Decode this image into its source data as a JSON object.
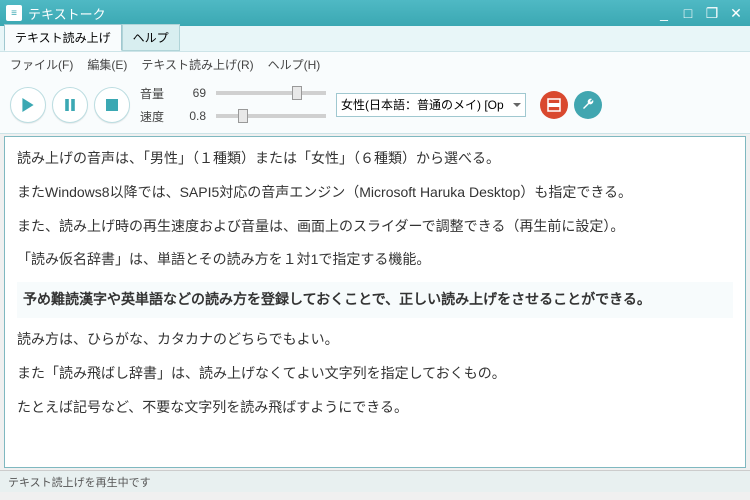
{
  "window": {
    "title": "テキストーク"
  },
  "tabs": [
    {
      "label": "テキスト読み上げ",
      "active": true
    },
    {
      "label": "ヘルプ",
      "active": false
    }
  ],
  "menu": {
    "file": "ファイル(F)",
    "edit": "編集(E)",
    "read": "テキスト読み上げ(R)",
    "help": "ヘルプ(H)"
  },
  "controls": {
    "volume_label": "音量",
    "volume_value": "69",
    "speed_label": "速度",
    "speed_value": "0.8",
    "voice_selected": "女性(日本語：普通のメイ) [Op"
  },
  "body": {
    "p1": "読み上げの音声は、「男性」（１種類）または「女性」（６種類）から選べる。",
    "p2": "またWindows8以降では、SAPI5対応の音声エンジン（Microsoft Haruka Desktop）も指定できる。",
    "p3": "また、読み上げ時の再生速度および音量は、画面上のスライダーで調整できる（再生前に設定）。",
    "p4": "「読み仮名辞書」は、単語とその読み方を１対1で指定する機能。",
    "p5": "予め難読漢字や英単語などの読み方を登録しておくことで、正しい読み上げをさせることができる。",
    "p6": "読み方は、ひらがな、カタカナのどちらでもよい。",
    "p7": "また「読み飛ばし辞書」は、読み上げなくてよい文字列を指定しておくもの。",
    "p8": "たとえば記号など、不要な文字列を読み飛ばすようにできる。"
  },
  "status": {
    "text": "テキスト読上げを再生中です"
  }
}
